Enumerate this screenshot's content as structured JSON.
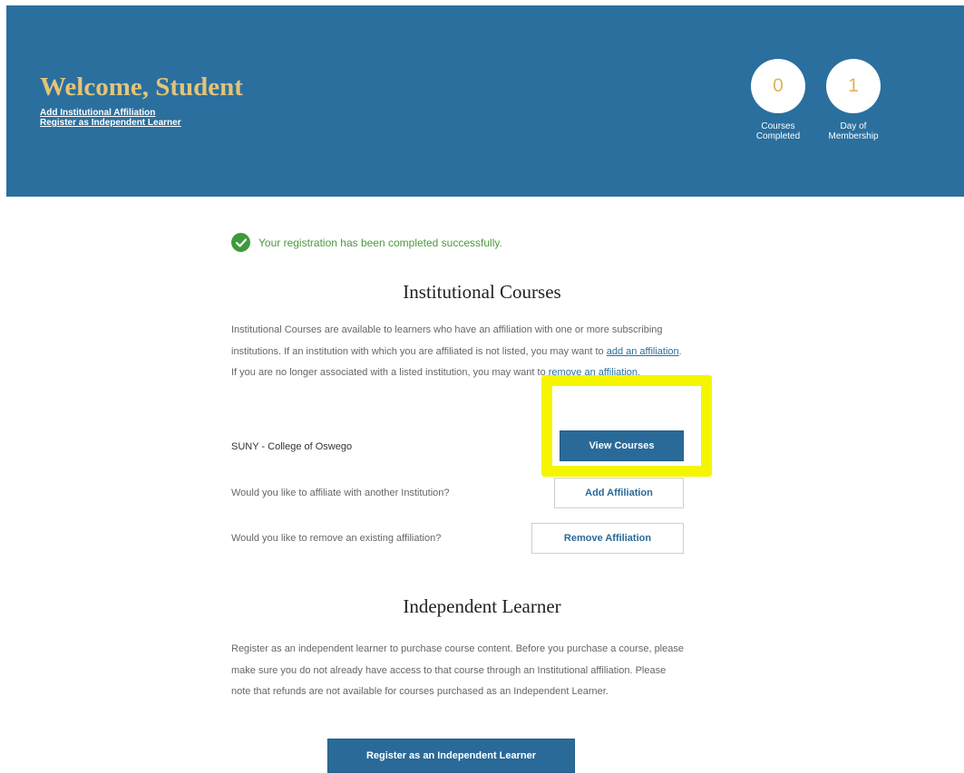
{
  "header": {
    "title": "Welcome, Student",
    "links": {
      "add_affiliation": "Add Institutional Affiliation",
      "register_independent": "Register as Independent Learner"
    },
    "stats": [
      {
        "value": "0",
        "label_line1": "Courses",
        "label_line2": "Completed"
      },
      {
        "value": "1",
        "label_line1": "Day of",
        "label_line2": "Membership"
      }
    ]
  },
  "success_message": "Your registration has been completed successfully.",
  "institutional": {
    "title": "Institutional Courses",
    "desc_part1": "Institutional Courses are available to learners who have an affiliation with one or more subscribing institutions. If an institution with which you are affiliated is not listed, you may want to ",
    "desc_link1": "add an affiliation",
    "desc_part2": ". If you are no longer associated with a listed institution, you may want to ",
    "desc_link2": "remove an affiliation",
    "desc_part3": ".",
    "institution_name": "SUNY - College of Oswego",
    "view_courses_label": "View Courses",
    "affiliate_question": "Would you like to affiliate with another Institution?",
    "add_affiliation_label": "Add Affiliation",
    "remove_question": "Would you like to remove an existing affiliation?",
    "remove_affiliation_label": "Remove Affiliation"
  },
  "independent": {
    "title": "Independent Learner",
    "description": "Register as an independent learner to purchase course content. Before you purchase a course, please make sure you do not already have access to that course through an Institutional affiliation. Please note that refunds are not available for courses purchased as an Independent Learner.",
    "register_label": "Register as an Independent Learner"
  },
  "colors": {
    "header_bg": "#2a6f9e",
    "title_gold": "#e3c37a",
    "primary_button": "#2a6a98",
    "success_green": "#3e9a3a",
    "highlight_yellow": "#f6f500"
  }
}
